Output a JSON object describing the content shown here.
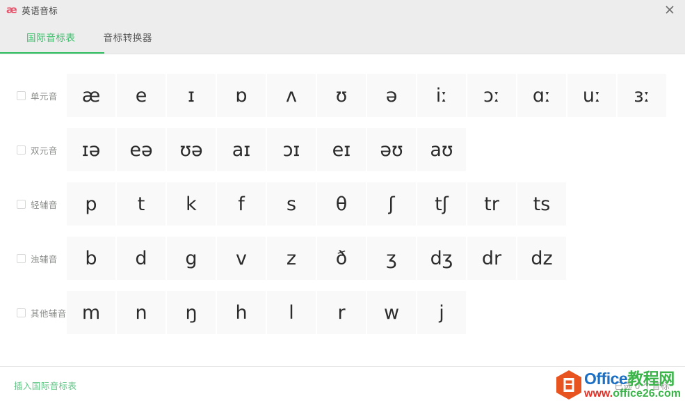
{
  "window": {
    "logo_glyph": "æ",
    "title": "英语音标",
    "logo_color": "#e8536b",
    "close_icon": "close-icon"
  },
  "tabs": [
    {
      "label": "国际音标表",
      "active": true
    },
    {
      "label": "音标转换器",
      "active": false
    }
  ],
  "accent_color": "#2ebd5e",
  "rows": [
    {
      "label": "单元音",
      "checked": false,
      "symbols": [
        "æ",
        "e",
        "ɪ",
        "ɒ",
        "ʌ",
        "ʊ",
        "ə",
        "iː",
        "ɔː",
        "ɑː",
        "uː",
        "ɜː"
      ]
    },
    {
      "label": "双元音",
      "checked": false,
      "symbols": [
        "ɪə",
        "eə",
        "ʊə",
        "aɪ",
        "ɔɪ",
        "eɪ",
        "əʊ",
        "aʊ"
      ]
    },
    {
      "label": "轻辅音",
      "checked": false,
      "symbols": [
        "p",
        "t",
        "k",
        "f",
        "s",
        "θ",
        "ʃ",
        "tʃ",
        "tr",
        "ts"
      ]
    },
    {
      "label": "浊辅音",
      "checked": false,
      "symbols": [
        "b",
        "d",
        "g",
        "v",
        "z",
        "ð",
        "ʒ",
        "dʒ",
        "dr",
        "dz"
      ]
    },
    {
      "label": "其他辅音",
      "checked": false,
      "symbols": [
        "m",
        "n",
        "ŋ",
        "h",
        "l",
        "r",
        "w",
        "j"
      ]
    }
  ],
  "footer": {
    "insert_label": "插入国际音标表",
    "status_text": "已选 0 个音标"
  },
  "watermark": {
    "brand": "Office",
    "brand_cn": "教程网",
    "url_prefix": "www.",
    "url_domain": "office26.com",
    "logo_icon": "office-hexagon-icon"
  }
}
